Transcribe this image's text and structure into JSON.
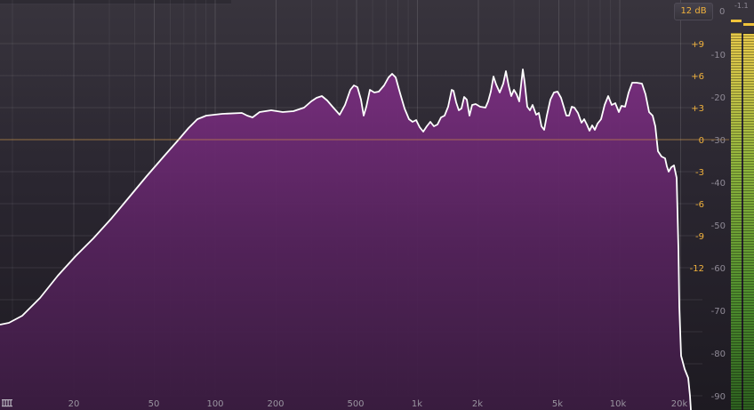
{
  "range_button": "12 dB",
  "meter": {
    "zero_label": "0",
    "peak_readout": "-1.1"
  },
  "freq_axis": {
    "labels": [
      "20",
      "50",
      "100",
      "200",
      "500",
      "1k",
      "2k",
      "5k",
      "10k",
      "20k"
    ]
  },
  "gain_axis": {
    "labels": [
      "+9",
      "+6",
      "+3",
      "0",
      "-3",
      "-6",
      "-9",
      "-12"
    ]
  },
  "level_axis": {
    "labels": [
      "-10",
      "-20",
      "-30",
      "-40",
      "-50",
      "-60",
      "-70",
      "-80",
      "-90"
    ]
  },
  "colors": {
    "accent": "#f0b13c",
    "spectrum_fill": "#6e2a73",
    "curve": "#ffffff",
    "meter": "#7fb23a"
  }
}
